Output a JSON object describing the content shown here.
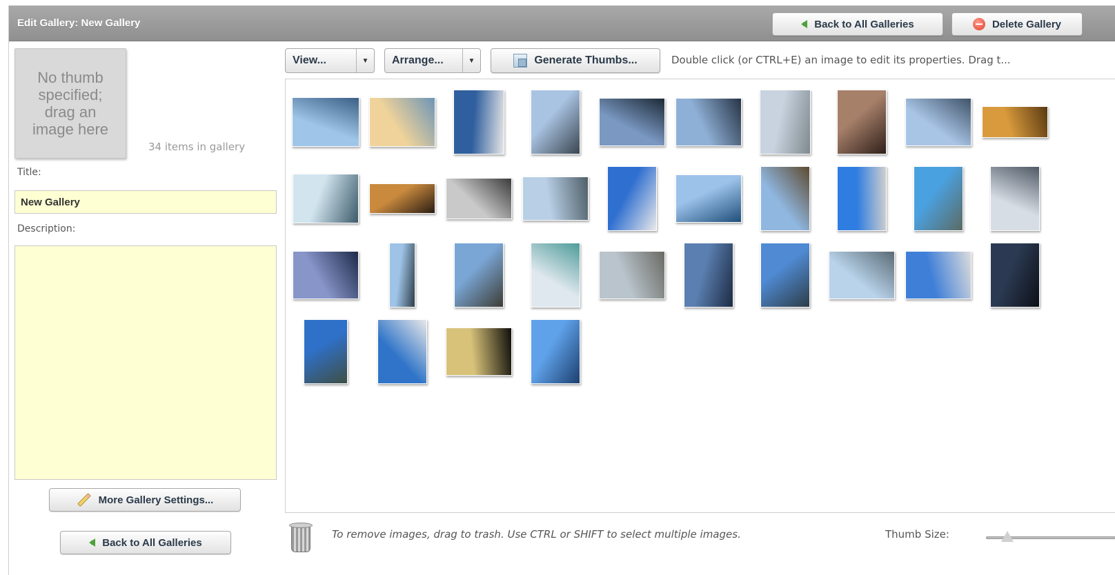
{
  "header": {
    "title": "Edit Gallery: New Gallery",
    "back_button": "Back to All Galleries",
    "delete_button": "Delete Gallery"
  },
  "sidebar": {
    "thumb_placeholder": "No thumb specified; drag an image here",
    "item_count": "34 items in gallery",
    "title_label": "Title:",
    "title_value": "New Gallery",
    "description_label": "Description:",
    "description_value": "",
    "more_settings_button": "More Gallery Settings...",
    "back_button": "Back to All Galleries"
  },
  "toolbar": {
    "view_label": "View...",
    "arrange_label": "Arrange...",
    "generate_label": "Generate Thumbs...",
    "hint": "Double click (or CTRL+E) an image to edit its properties.  Drag t..."
  },
  "footer": {
    "trash_hint": "To remove images, drag to trash.  Use CTRL or SHIFT to select multiple images.",
    "thumb_size_label": "Thumb Size:"
  },
  "gallery": {
    "image_count": 34,
    "images": [
      {
        "colors": [
          "#9fc6e8",
          "#3b5f86"
        ]
      },
      {
        "colors": [
          "#f0d39a",
          "#6d95b6"
        ]
      },
      {
        "colors": [
          "#2f5f9e",
          "#e6e6e6"
        ]
      },
      {
        "colors": [
          "#a9c3e2",
          "#3a4650"
        ]
      },
      {
        "colors": [
          "#7a98c2",
          "#1c2a36"
        ]
      },
      {
        "colors": [
          "#8fb0d6",
          "#273446"
        ]
      },
      {
        "colors": [
          "#c8d3df",
          "#7f8a8f"
        ]
      },
      {
        "colors": [
          "#a7806a",
          "#2f1f1a"
        ]
      },
      {
        "colors": [
          "#a9c5e6",
          "#40546a"
        ]
      },
      {
        "colors": [
          "#d89a3c",
          "#5a3a12"
        ]
      },
      {
        "colors": [
          "#d2e5ef",
          "#3d5b6b"
        ]
      },
      {
        "colors": [
          "#c98a3e",
          "#2a1c12"
        ]
      },
      {
        "colors": [
          "#c9c9c9",
          "#3c3c3c"
        ]
      },
      {
        "colors": [
          "#b8cfe6",
          "#4f5f68"
        ]
      },
      {
        "colors": [
          "#2f6fd0",
          "#e9e9e9"
        ]
      },
      {
        "colors": [
          "#9cc2ea",
          "#1f4f7a"
        ]
      },
      {
        "colors": [
          "#8fb7e0",
          "#5e4a30"
        ]
      },
      {
        "colors": [
          "#2f7de0",
          "#cfcfcf"
        ]
      },
      {
        "colors": [
          "#4aa1e0",
          "#5b6b64"
        ]
      },
      {
        "colors": [
          "#d7dde5",
          "#4f5a66"
        ]
      },
      {
        "colors": [
          "#8795c9",
          "#1e2a4a"
        ]
      },
      {
        "colors": [
          "#9ec3e6",
          "#2e3e4a"
        ]
      },
      {
        "colors": [
          "#7aa6d6",
          "#3d3d35"
        ]
      },
      {
        "colors": [
          "#dfe8ee",
          "#4f9b9a"
        ]
      },
      {
        "colors": [
          "#b9c4cc",
          "#6a6a64"
        ]
      },
      {
        "colors": [
          "#5a7fb0",
          "#1d2b44"
        ]
      },
      {
        "colors": [
          "#4f8ad2",
          "#2d3d48"
        ]
      },
      {
        "colors": [
          "#b8d3ea",
          "#5b6b76"
        ]
      },
      {
        "colors": [
          "#3f7fd8",
          "#dcdcdc"
        ]
      },
      {
        "colors": [
          "#2b3a52",
          "#0d1018"
        ]
      },
      {
        "colors": [
          "#2f70c8",
          "#3f4f45"
        ]
      },
      {
        "colors": [
          "#2f74c8",
          "#e8e8e8"
        ]
      },
      {
        "colors": [
          "#d8c27a",
          "#0f0f0a"
        ]
      },
      {
        "colors": [
          "#5fa2ea",
          "#1d3f6e"
        ]
      }
    ]
  }
}
